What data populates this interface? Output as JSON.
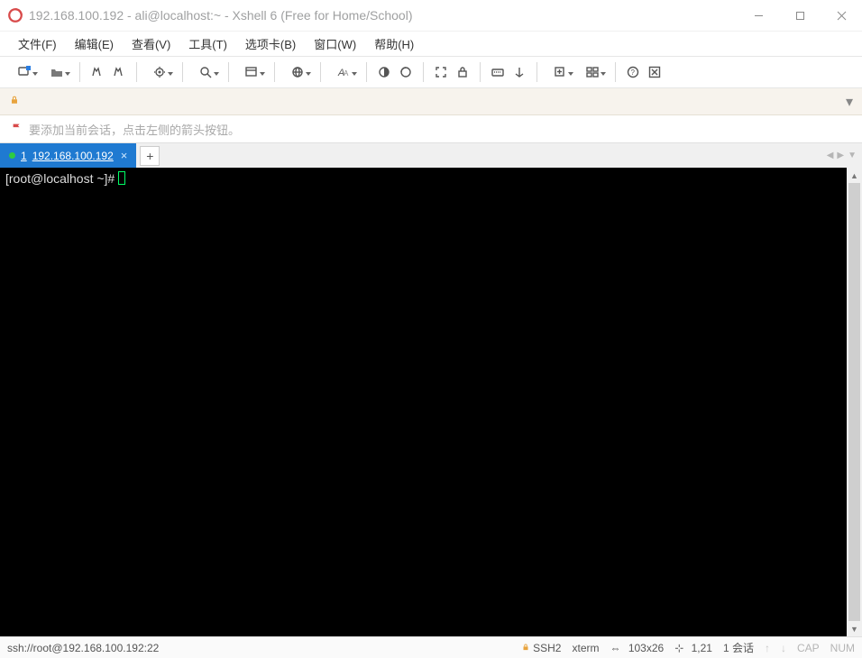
{
  "window": {
    "title": "192.168.100.192 - ali@localhost:~ - Xshell 6 (Free for Home/School)"
  },
  "menu": {
    "items": [
      {
        "label": "文件(F)"
      },
      {
        "label": "编辑(E)"
      },
      {
        "label": "查看(V)"
      },
      {
        "label": "工具(T)"
      },
      {
        "label": "选项卡(B)"
      },
      {
        "label": "窗口(W)"
      },
      {
        "label": "帮助(H)"
      }
    ]
  },
  "toolbar": {
    "icons": [
      "new-session-icon",
      "open-icon",
      "sep",
      "copy-icon",
      "paste-icon",
      "sep",
      "properties-icon",
      "sep",
      "find-icon",
      "sep",
      "encoding-icon",
      "sep",
      "globe-icon",
      "sep",
      "font-icon",
      "sep",
      "color-scheme-icon",
      "reconnect-icon",
      "sep",
      "fullscreen-icon",
      "lock-icon",
      "sep",
      "keyboard-icon",
      "transfer-icon",
      "sep",
      "new-tab-icon",
      "tile-icon",
      "sep",
      "help-icon",
      "exit-icon"
    ]
  },
  "addressbar": {
    "value": "",
    "placeholder": ""
  },
  "tipbar": {
    "text": "要添加当前会话，点击左侧的箭头按钮。"
  },
  "tabs": {
    "items": [
      {
        "index": "1",
        "label": "192.168.100.192",
        "active": true,
        "status": "connected"
      }
    ],
    "add_label": "+"
  },
  "terminal": {
    "prompt": "[root@localhost ~]# "
  },
  "statusbar": {
    "connection": "ssh://root@192.168.100.192:22",
    "protocol": "SSH2",
    "termtype": "xterm",
    "size": "103x26",
    "rowcol": "1,21",
    "session_count": "1 会话",
    "cap": "CAP",
    "num": "NUM"
  }
}
